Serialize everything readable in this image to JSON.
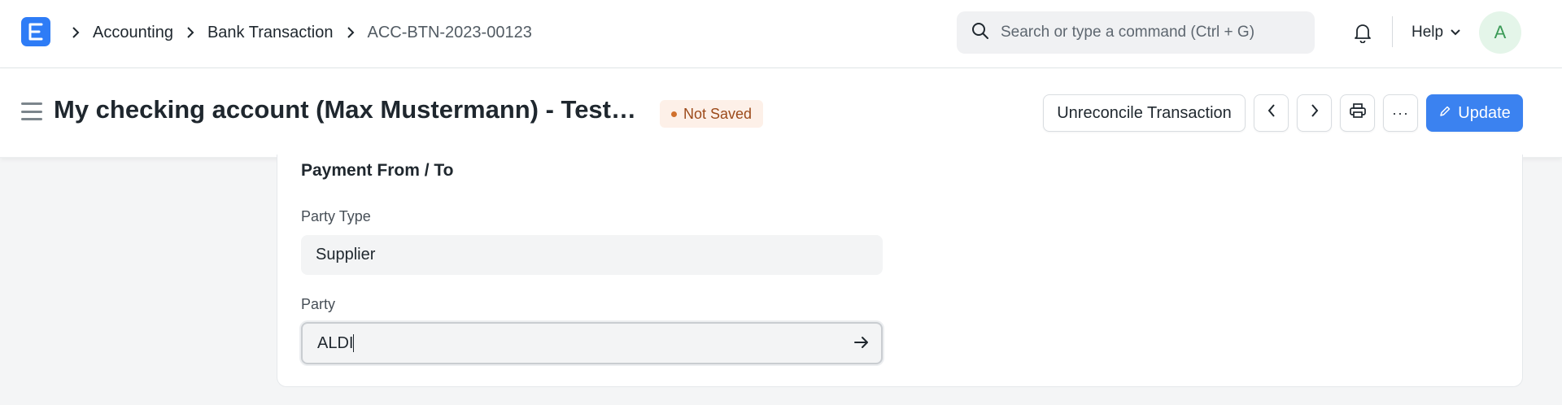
{
  "navbar": {
    "breadcrumbs": [
      "Accounting",
      "Bank Transaction",
      "ACC-BTN-2023-00123"
    ],
    "search": {
      "placeholder": "Search or type a command (Ctrl + G)"
    },
    "help_label": "Help",
    "avatar_initial": "A"
  },
  "page_head": {
    "title": "My checking account (Max Mustermann) - Testbank",
    "status": "Not Saved",
    "actions": {
      "unreconcile_label": "Unreconcile Transaction",
      "more_label": "···",
      "update_label": "Update"
    }
  },
  "form": {
    "section_title": "Payment From / To",
    "fields": [
      {
        "label": "Party Type",
        "value": "Supplier"
      },
      {
        "label": "Party",
        "value": "ALDI"
      }
    ]
  },
  "colors": {
    "primary": "#3b82f0",
    "logo_bg": "#2e7cf6",
    "status_text": "#9c4a1a",
    "status_bg": "#fdf0e8",
    "avatar_text": "#3a9a56",
    "avatar_bg": "#e4f5e9"
  },
  "icons": [
    "app-logo-icon",
    "chevron-right-icon",
    "search-icon",
    "bell-icon",
    "chevron-down-icon",
    "menu-icon",
    "chevron-left-icon",
    "printer-icon",
    "pencil-icon",
    "arrow-right-icon"
  ]
}
